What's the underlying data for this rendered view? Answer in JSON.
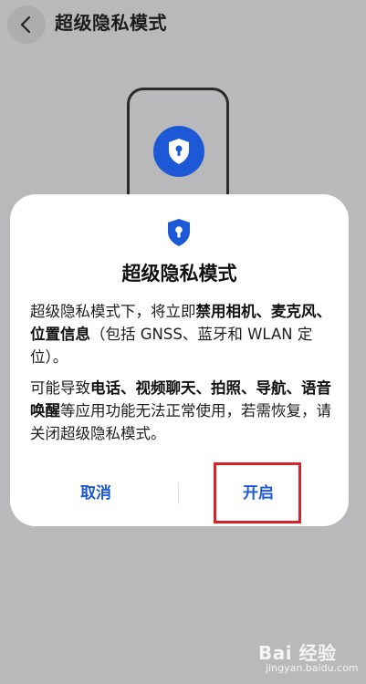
{
  "header": {
    "title": "超级隐私模式",
    "back_icon": "chevron-left-icon"
  },
  "illustration": {
    "icon": "shield-keyhole-icon",
    "accent": "#1d58d6"
  },
  "dialog": {
    "icon": "shield-keyhole-icon",
    "title": "超级隐私模式",
    "paragraph1": {
      "t1": "超级隐私模式下，将立即",
      "b1": "禁用相机、麦克风、位置信息",
      "t2": "（包括 GNSS、蓝牙和 WLAN 定位）。"
    },
    "paragraph2": {
      "t1": "可能导致",
      "b1": "电话、视频聊天、拍照、导航、语音唤醒",
      "t2": "等应用功能无法正常使用，若需恢复，请关闭超级隐私模式。"
    },
    "cancel_label": "取消",
    "open_label": "开启"
  },
  "annotation": {
    "color": "#d9232a"
  },
  "watermark": {
    "logo": "Bai 经验",
    "url": "jingyan.baidu.com"
  }
}
